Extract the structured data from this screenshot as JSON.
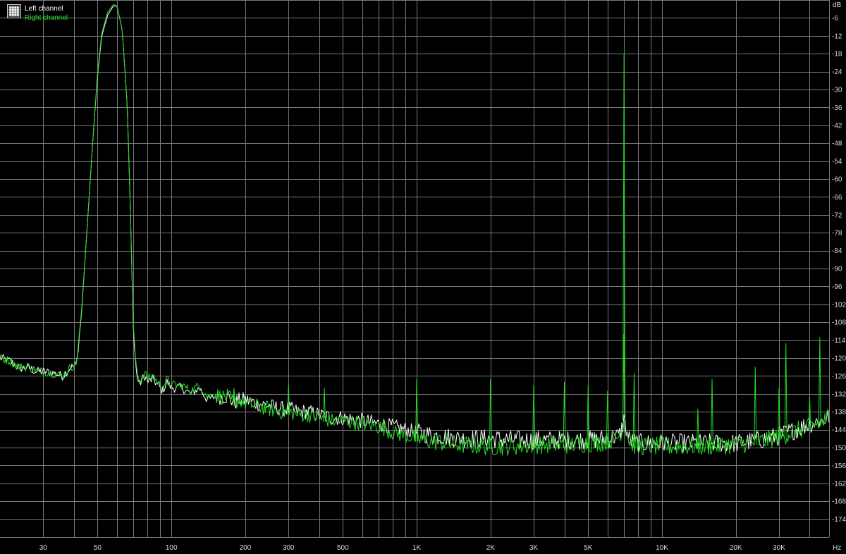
{
  "colors": {
    "background": "#000000",
    "grid": "#7a7a7a",
    "axis_text": "#d8d8d8",
    "left_channel": "#ffffff",
    "right_channel": "#22dd22"
  },
  "legend": {
    "icon": "grid-legend-icon",
    "left_label": "Left channel",
    "right_label": "Right channel"
  },
  "chart_data": {
    "type": "line",
    "x_scale": "log",
    "xlim": [
      20,
      48000
    ],
    "ylim": [
      -180,
      0
    ],
    "grid": true,
    "legend_position": "top-left",
    "xlabel": "Hz",
    "ylabel": "dB",
    "x_ticks": [
      {
        "v": 30,
        "label": "30"
      },
      {
        "v": 50,
        "label": "50"
      },
      {
        "v": 100,
        "label": "100"
      },
      {
        "v": 200,
        "label": "200"
      },
      {
        "v": 300,
        "label": "300"
      },
      {
        "v": 500,
        "label": "500"
      },
      {
        "v": 1000,
        "label": "1K"
      },
      {
        "v": 2000,
        "label": "2K"
      },
      {
        "v": 3000,
        "label": "3K"
      },
      {
        "v": 5000,
        "label": "5K"
      },
      {
        "v": 10000,
        "label": "10K"
      },
      {
        "v": 20000,
        "label": "20K"
      },
      {
        "v": 30000,
        "label": "30K"
      }
    ],
    "y_ticks": [
      -6,
      -12,
      -18,
      -24,
      -30,
      -36,
      -42,
      -48,
      -54,
      -60,
      -66,
      -72,
      -78,
      -84,
      -90,
      -96,
      -102,
      -108,
      -114,
      -120,
      -126,
      -132,
      -138,
      -144,
      -150,
      -156,
      -162,
      -168,
      -174
    ],
    "series": [
      {
        "name": "Left channel",
        "color": "#ffffff",
        "x": [
          20,
          22,
          24,
          26,
          28,
          30,
          33,
          36,
          39,
          41,
          43,
          45,
          48,
          50,
          52,
          55,
          58,
          60,
          63,
          66,
          68,
          70,
          72,
          74,
          76,
          78,
          80,
          84,
          88,
          92,
          96,
          100,
          110,
          120,
          130,
          140,
          150,
          160,
          170,
          180,
          190,
          200,
          220,
          250,
          280,
          300,
          330,
          360,
          400,
          450,
          500,
          600,
          700,
          800,
          900,
          1000,
          1200,
          1500,
          2000,
          2500,
          3000,
          4000,
          5000,
          6000,
          6700,
          6900,
          7000,
          7100,
          7300,
          7600,
          8000,
          9000,
          10000,
          12000,
          15000,
          20000,
          25000,
          30000,
          35000,
          40000,
          45000,
          48000
        ],
        "y": [
          -120,
          -121,
          -123.5,
          -123,
          -124.5,
          -124.5,
          -125,
          -126,
          -123,
          -122.5,
          -105,
          -80,
          -45,
          -25,
          -12,
          -5,
          -2,
          -2,
          -10,
          -35,
          -70,
          -112,
          -125,
          -129,
          -127,
          -126,
          -128,
          -127,
          -129,
          -131,
          -128,
          -130,
          -130,
          -132,
          -130,
          -134,
          -133,
          -133,
          -133,
          -135,
          -134,
          -134,
          -135,
          -136,
          -137,
          -137,
          -138,
          -138,
          -139,
          -140,
          -140,
          -141,
          -142,
          -143,
          -144,
          -145,
          -146,
          -147,
          -147,
          -147.5,
          -147.5,
          -147.5,
          -147.5,
          -147,
          -146,
          -143,
          -140,
          -143,
          -147,
          -148,
          -148.5,
          -148.5,
          -148.5,
          -148.5,
          -148.5,
          -148.5,
          -147.5,
          -146,
          -144,
          -142,
          -141,
          -139.5
        ]
      },
      {
        "name": "Right channel",
        "color": "#22dd22",
        "x": [
          20,
          22,
          24,
          26,
          28,
          30,
          33,
          36,
          39,
          41,
          43,
          45,
          48,
          50,
          52,
          55,
          58,
          60,
          63,
          66,
          68,
          70,
          72,
          74,
          76,
          78,
          80,
          84,
          88,
          92,
          96,
          100,
          110,
          120,
          130,
          140,
          150,
          160,
          170,
          180,
          190,
          200,
          220,
          250,
          280,
          300,
          330,
          360,
          400,
          450,
          500,
          600,
          700,
          800,
          900,
          1000,
          1200,
          1500,
          2000,
          2500,
          3000,
          4000,
          5000,
          6000,
          6700,
          6900,
          7000,
          7100,
          7300,
          7600,
          8000,
          9000,
          10000,
          12000,
          15000,
          20000,
          25000,
          30000,
          35000,
          40000,
          45000,
          48000
        ],
        "y": [
          -120,
          -121,
          -123,
          -123,
          -124,
          -124.5,
          -125,
          -126,
          -123,
          -122,
          -104,
          -80,
          -45,
          -24,
          -11,
          -4,
          -1.5,
          -2,
          -10,
          -35,
          -70,
          -111,
          -124,
          -128,
          -126,
          -125,
          -127,
          -126,
          -128,
          -130,
          -127,
          -129,
          -129,
          -131,
          -129,
          -133,
          -132,
          -133,
          -133,
          -135,
          -134,
          -135,
          -136,
          -137,
          -138,
          -138,
          -139,
          -139,
          -140,
          -141,
          -141,
          -142,
          -143,
          -145,
          -146,
          -147,
          -148,
          -149,
          -149.5,
          -149.5,
          -149,
          -149,
          -148.5,
          -148,
          -146,
          -143,
          -140,
          -143,
          -147,
          -149,
          -149.5,
          -149.5,
          -149.5,
          -149.5,
          -149.5,
          -149,
          -148,
          -146.5,
          -144.5,
          -143,
          -141.5,
          -140
        ]
      }
    ],
    "spikes": [
      {
        "x": 180,
        "y": -130
      },
      {
        "x": 300,
        "y": -129
      },
      {
        "x": 420,
        "y": -130
      },
      {
        "x": 1000,
        "y": -127
      },
      {
        "x": 2000,
        "y": -127
      },
      {
        "x": 3000,
        "y": -129
      },
      {
        "x": 4000,
        "y": -128
      },
      {
        "x": 5000,
        "y": -129
      },
      {
        "x": 6000,
        "y": -131
      },
      {
        "x": 7000,
        "y": -18
      },
      {
        "x": 7000,
        "y": -112
      },
      {
        "x": 7700,
        "y": -125
      },
      {
        "x": 14000,
        "y": -137
      },
      {
        "x": 16000,
        "y": -127
      },
      {
        "x": 24000,
        "y": -123
      },
      {
        "x": 30000,
        "y": -130
      },
      {
        "x": 32000,
        "y": -115
      },
      {
        "x": 40000,
        "y": -133
      },
      {
        "x": 44000,
        "y": -113
      }
    ]
  }
}
